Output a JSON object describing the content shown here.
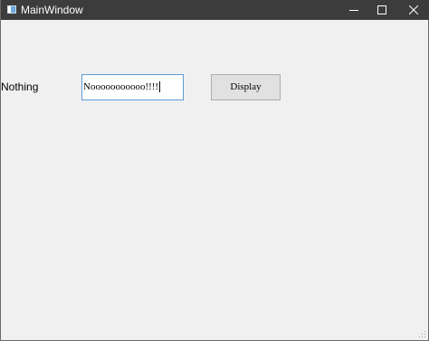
{
  "window": {
    "title": "MainWindow"
  },
  "titlebar": {
    "icons": {
      "app": "app-window-icon",
      "minimize": "minimize-icon",
      "maximize": "maximize-icon",
      "close": "close-icon"
    }
  },
  "main": {
    "label_text": "Nothing",
    "input_value": "Nooooooooooo!!!!",
    "button_label": "Display"
  },
  "colors": {
    "titlebar": "#3c3c3c",
    "client_bg": "#f0f0f0",
    "input_focus_border": "#5a9bd5",
    "button_bg": "#e1e1e1"
  }
}
